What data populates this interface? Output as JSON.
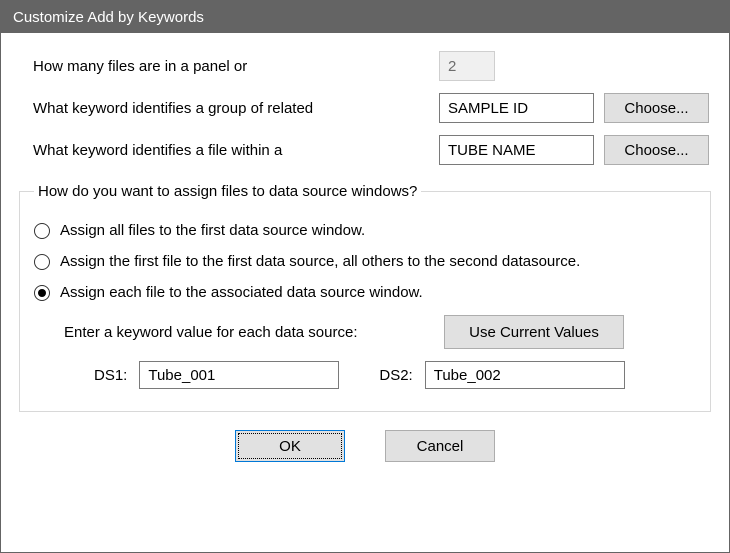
{
  "title": "Customize Add by Keywords",
  "questions": {
    "files_per_panel_label": "How many files are in a panel or",
    "files_per_panel_value": "2",
    "group_keyword_label": "What keyword identifies a group of related",
    "group_keyword_value": "SAMPLE ID",
    "file_keyword_label": "What keyword identifies a file within a",
    "file_keyword_value": "TUBE NAME",
    "choose_label": "Choose..."
  },
  "assign": {
    "legend": "How do you want to assign files to data source windows?",
    "options": [
      "Assign all files to the first data source window.",
      "Assign the first file to the first data source, all others to the second datasource.",
      "Assign each file to the associated data source window."
    ],
    "selected_index": 2,
    "enter_label": "Enter a keyword value for each data source:",
    "use_current_label": "Use Current Values",
    "sources": [
      {
        "label": "DS1:",
        "value": "Tube_001"
      },
      {
        "label": "DS2:",
        "value": "Tube_002"
      }
    ]
  },
  "buttons": {
    "ok": "OK",
    "cancel": "Cancel"
  }
}
